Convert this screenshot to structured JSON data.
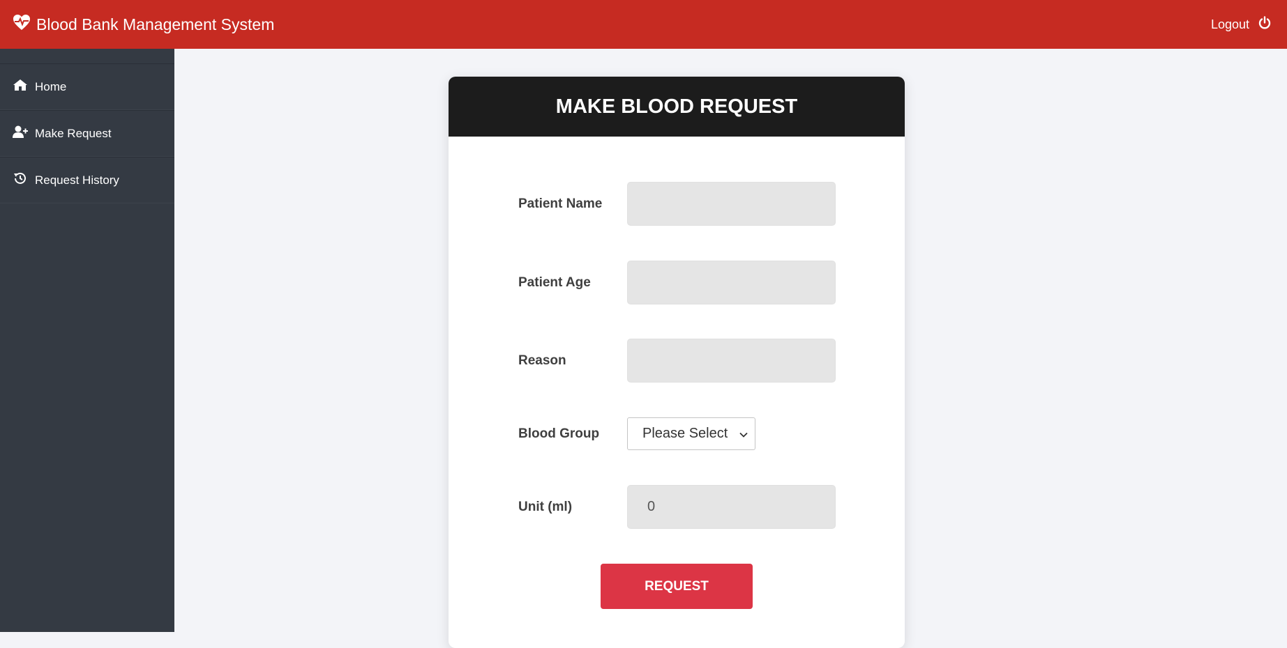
{
  "header": {
    "app_title": "Blood Bank Management System",
    "logout_label": "Logout",
    "brand_icon": "heartbeat-icon",
    "logout_icon": "power-icon"
  },
  "sidebar": {
    "items": [
      {
        "label": "Home",
        "icon": "home-icon"
      },
      {
        "label": "Make Request",
        "icon": "user-plus-icon"
      },
      {
        "label": "Request History",
        "icon": "history-icon"
      }
    ]
  },
  "form": {
    "title": "MAKE BLOOD REQUEST",
    "patient_name": {
      "label": "Patient Name",
      "value": ""
    },
    "patient_age": {
      "label": "Patient Age",
      "value": ""
    },
    "reason": {
      "label": "Reason",
      "value": ""
    },
    "blood_group": {
      "label": "Blood Group",
      "selected": "Please Select"
    },
    "unit": {
      "label": "Unit (ml)",
      "value": "0"
    },
    "submit_label": "REQUEST"
  },
  "colors": {
    "topbar": "#c62b22",
    "sidebar": "#343a43",
    "card_header": "#1c1c1c",
    "button": "#dc3545",
    "background": "#f3f4f8"
  }
}
